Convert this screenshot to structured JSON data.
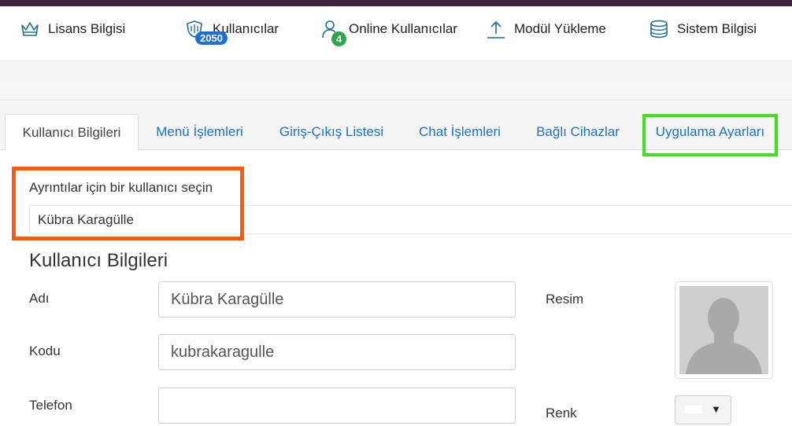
{
  "header": {
    "nav": [
      {
        "label": "Lisans Bilgisi",
        "icon": "crown-icon"
      },
      {
        "label": "Kullanıcılar",
        "icon": "shield-icon",
        "badge": "2050"
      },
      {
        "label": "Online Kullanıcılar",
        "icon": "user-icon",
        "badge": "4"
      },
      {
        "label": "Modül Yükleme",
        "icon": "upload-icon"
      },
      {
        "label": "Sistem Bilgisi",
        "icon": "database-icon"
      }
    ]
  },
  "tabs": [
    {
      "label": "Kullanıcı Bilgileri",
      "active": true
    },
    {
      "label": "Menü İşlemleri"
    },
    {
      "label": "Giriş-Çıkış Listesi"
    },
    {
      "label": "Chat İşlemleri"
    },
    {
      "label": "Bağlı Cihazlar"
    },
    {
      "label": "Uygulama Ayarları"
    }
  ],
  "user_select": {
    "label": "Ayrıntılar için bir kullanıcı seçin",
    "value": "Kübra Karagülle"
  },
  "form": {
    "title": "Kullanıcı Bilgileri",
    "name_label": "Adı",
    "name_value": "Kübra Karagülle",
    "code_label": "Kodu",
    "code_value": "kubrakaragulle",
    "phone_label": "Telefon",
    "phone_value": "",
    "image_label": "Resim",
    "color_label": "Renk"
  },
  "colors": {
    "link": "#1a73c8",
    "badge_blue": "#1b6fd6",
    "badge_green": "#2ea64c",
    "highlight_green": "#3fe21b",
    "highlight_orange": "#ff5a0a",
    "icon": "#1d6f8a"
  }
}
